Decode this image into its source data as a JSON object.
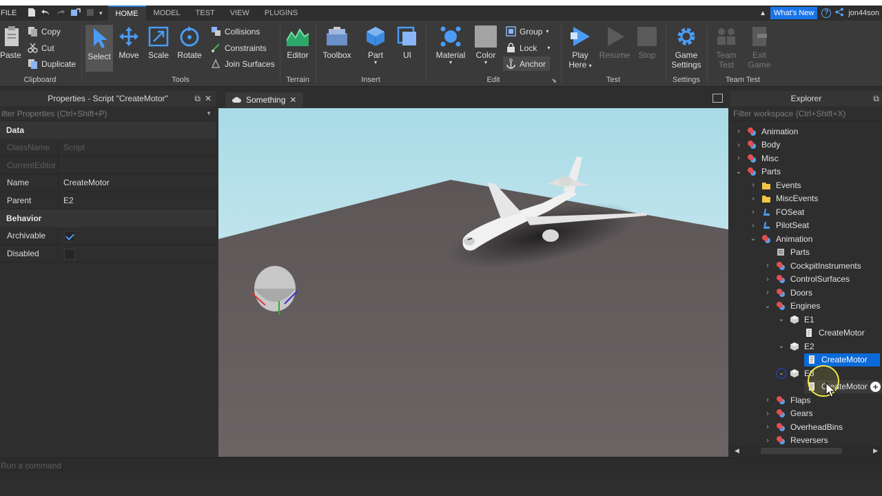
{
  "menu": {
    "file": "FILE",
    "tabs": [
      "HOME",
      "MODEL",
      "TEST",
      "VIEW",
      "PLUGINS"
    ],
    "whats_new": "What's New",
    "username": "jon44son"
  },
  "ribbon": {
    "clipboard": {
      "label": "Clipboard",
      "paste": "Paste",
      "copy": "Copy",
      "cut": "Cut",
      "duplicate": "Duplicate"
    },
    "tools": {
      "label": "Tools",
      "select": "Select",
      "move": "Move",
      "scale": "Scale",
      "rotate": "Rotate",
      "collisions": "Collisions",
      "constraints": "Constraints",
      "join_surfaces": "Join Surfaces"
    },
    "terrain": {
      "label": "Terrain",
      "editor": "Editor"
    },
    "insert": {
      "label": "Insert",
      "toolbox": "Toolbox",
      "part": "Part",
      "ui": "UI"
    },
    "edit": {
      "label": "Edit",
      "material": "Material",
      "color": "Color",
      "group": "Group",
      "lock": "Lock",
      "anchor": "Anchor"
    },
    "test": {
      "label": "Test",
      "play_here_1": "Play",
      "play_here_2": "Here",
      "resume": "Resume",
      "stop": "Stop"
    },
    "settings": {
      "label": "Settings",
      "game_settings_1": "Game",
      "game_settings_2": "Settings"
    },
    "team_test": {
      "label": "Team Test",
      "team_test_1": "Team",
      "team_test_2": "Test",
      "exit_game_1": "Exit",
      "exit_game_2": "Game"
    }
  },
  "properties": {
    "title": "Properties - Script \"CreateMotor\"",
    "filter_placeholder": "ilter Properties (Ctrl+Shift+P)",
    "sections": {
      "data": "Data",
      "behavior": "Behavior"
    },
    "rows": {
      "classname": {
        "key": "ClassName",
        "value": "Script"
      },
      "currenteditor": {
        "key": "CurrentEditor",
        "value": ""
      },
      "name": {
        "key": "Name",
        "value": "CreateMotor"
      },
      "parent": {
        "key": "Parent",
        "value": "E2"
      },
      "archivable": {
        "key": "Archivable",
        "checked": true
      },
      "disabled": {
        "key": "Disabled",
        "checked": false
      }
    }
  },
  "viewport": {
    "tab_title": "Something"
  },
  "explorer": {
    "title": "Explorer",
    "filter_placeholder": "Filter workspace (Ctrl+Shift+X)",
    "nodes": [
      "Animation",
      "Body",
      "Misc",
      "Parts",
      "Events",
      "MiscEvents",
      "FOSeat",
      "PilotSeat",
      "Animation",
      "Parts",
      "CockpitInstruments",
      "ControlSurfaces",
      "Doors",
      "Engines",
      "E1",
      "CreateMotor",
      "E2",
      "CreateMotor",
      "E3",
      "CreateMotor",
      "Flaps",
      "Gears",
      "OverheadBins",
      "Reversers"
    ]
  },
  "command_bar": {
    "placeholder": "Run a command"
  },
  "colors": {
    "accent": "#0b6ad9",
    "whats_new": "#1a73e8",
    "panel": "#2e2e2e",
    "ribbon": "#3a3a3a"
  }
}
